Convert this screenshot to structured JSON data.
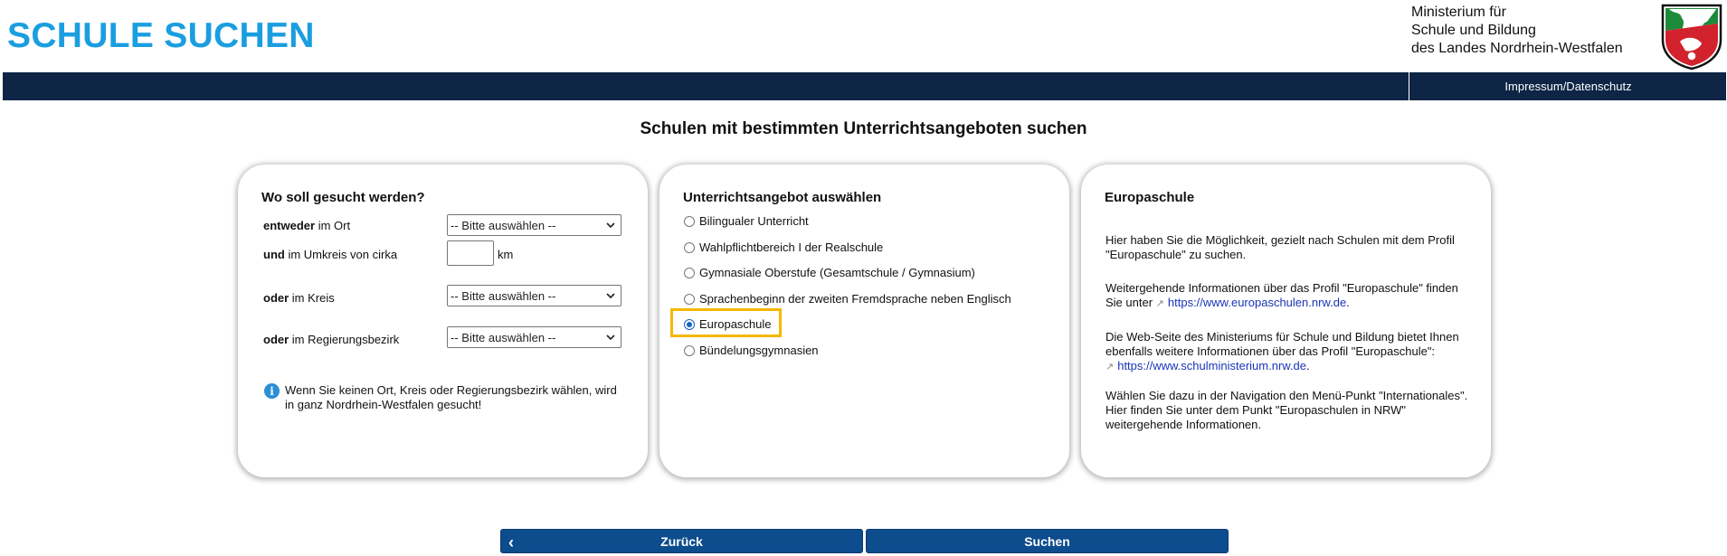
{
  "header": {
    "app_title": "SCHULE SUCHEN",
    "ministry_line1": "Ministerium für",
    "ministry_line2": "Schule und Bildung",
    "ministry_line3": "des Landes Nordrhein-Westfalen"
  },
  "nav": {
    "impressum": "Impressum/Datenschutz"
  },
  "page_heading": "Schulen mit bestimmten Unterrichtsangeboten suchen",
  "location_panel": {
    "title": "Wo soll gesucht werden?",
    "ort_bold": "entweder",
    "ort_rest": " im Ort",
    "umkreis_bold": "und",
    "umkreis_rest": " im Umkreis von cirka",
    "km_value": "",
    "km_unit": "km",
    "kreis_bold": "oder",
    "kreis_rest": " im Kreis",
    "bezirk_bold": "oder",
    "bezirk_rest": " im Regierungsbezirk",
    "select_placeholder": "-- Bitte auswählen --",
    "info_text": "Wenn Sie keinen Ort, Kreis oder Regierungsbezirk wählen, wird in ganz Nordrhein-Westfalen gesucht!"
  },
  "offer_panel": {
    "title": "Unterrichtsangebot auswählen",
    "options": [
      {
        "label": "Bilingualer Unterricht",
        "checked": false
      },
      {
        "label": "Wahlpflichtbereich I der Realschule",
        "checked": false
      },
      {
        "label": "Gymnasiale Oberstufe (Gesamtschule / Gymnasium)",
        "checked": false
      },
      {
        "label": "Sprachenbeginn der zweiten Fremdsprache neben Englisch",
        "checked": false
      },
      {
        "label": "Europaschule",
        "checked": true
      },
      {
        "label": "Bündelungsgymnasien",
        "checked": false
      }
    ],
    "highlight_color": "#f5b800"
  },
  "info_panel": {
    "title": "Europaschule",
    "p1": "Hier haben Sie die Möglichkeit, gezielt nach Schulen mit dem Profil \"Europaschule\" zu suchen.",
    "p2_text": "Weitergehende Informationen über das Profil \"Europaschule\" finden Sie unter",
    "p2_link": "https://www.europaschulen.nrw.de",
    "p3_text": "Die Web-Seite des Ministeriums für Schule und Bildung bietet Ihnen ebenfalls weitere Informationen über das Profil \"Europaschule\":",
    "p3_link": "https://www.schulministerium.nrw.de",
    "p4": "Wählen Sie dazu in der Navigation den Menü-Punkt \"Internationales\". Hier finden Sie unter dem Punkt \"Europaschulen in NRW\" weitergehende Informationen."
  },
  "buttons": {
    "back": "Zurück",
    "search": "Suchen"
  },
  "colors": {
    "title_blue": "#1a9ee0",
    "navbar": "#0e2545",
    "button": "#0d4c8d"
  },
  "icons": [
    "crest-icon",
    "chevron-down-icon",
    "info-icon",
    "external-link-icon",
    "chevron-left-icon"
  ]
}
